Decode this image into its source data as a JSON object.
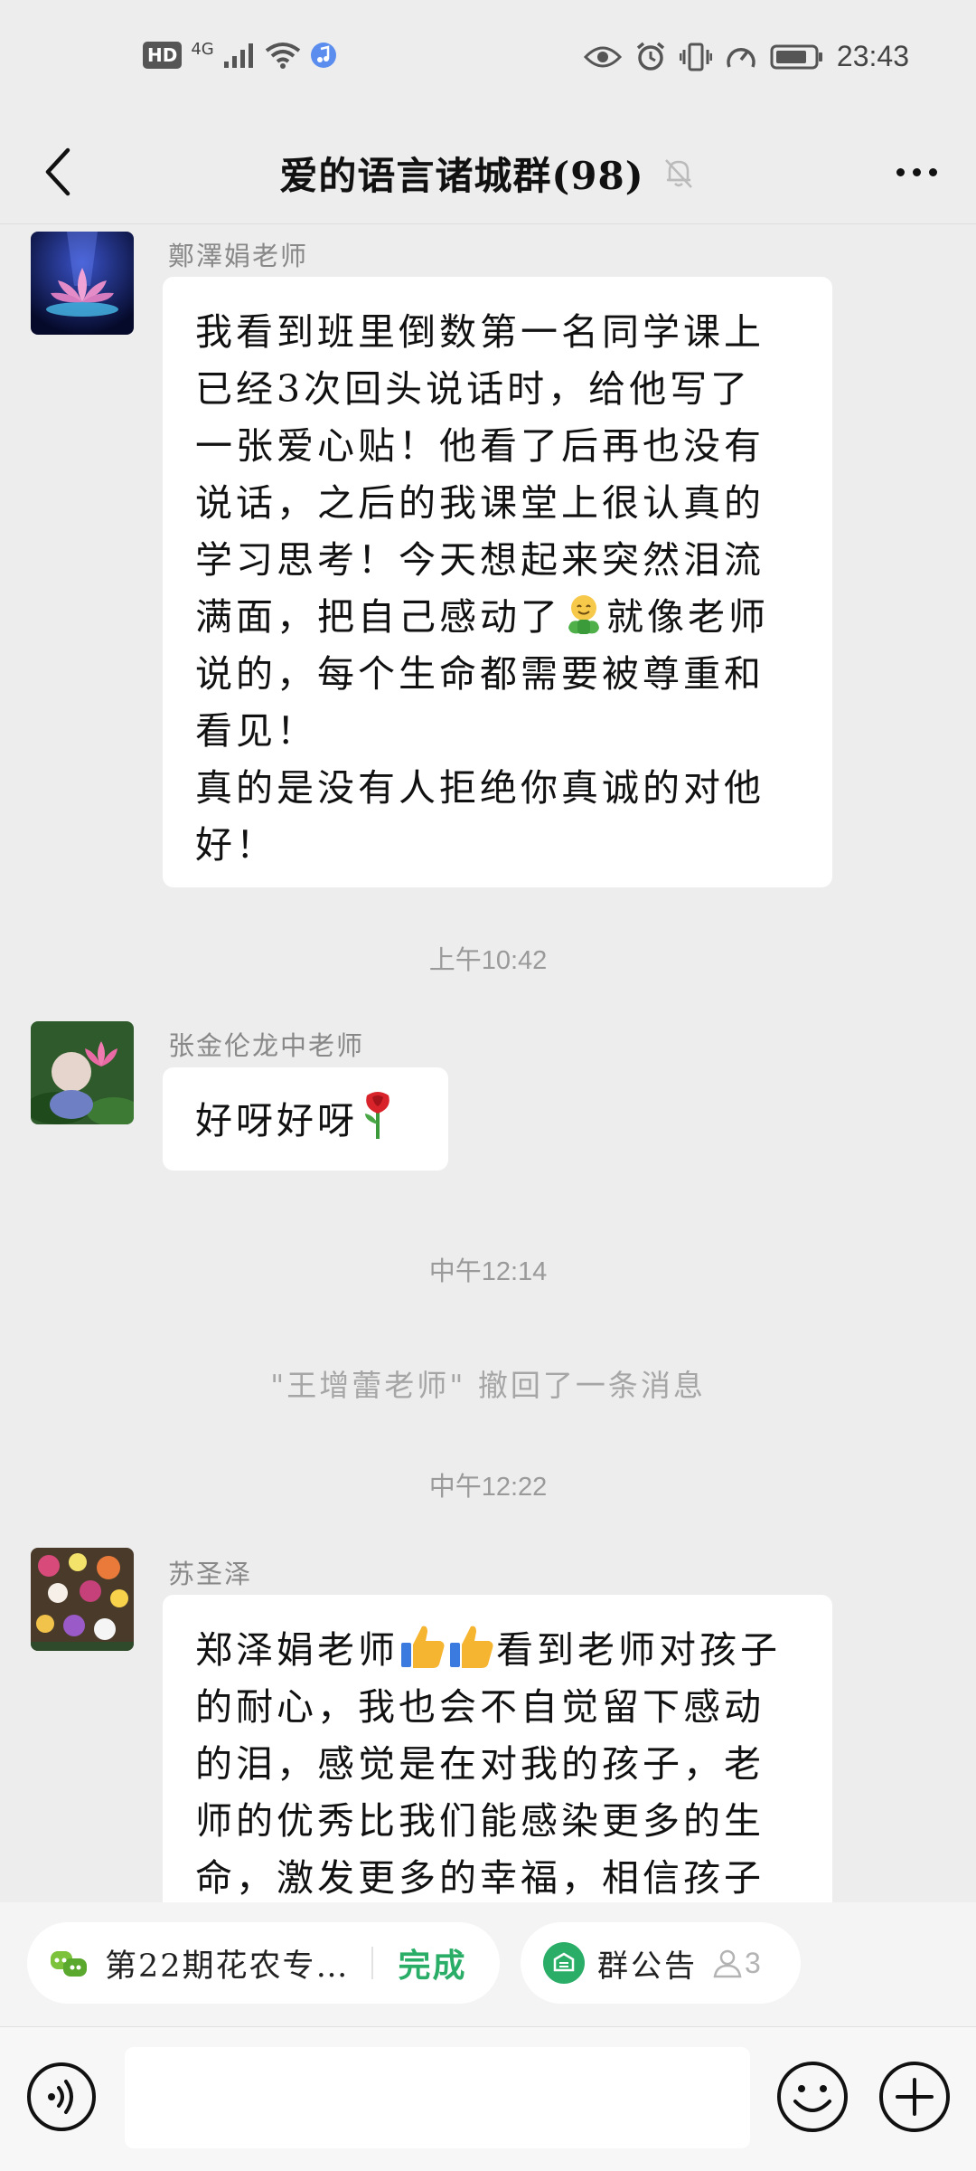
{
  "status_bar": {
    "hd": "HD",
    "network": "4G",
    "time": "23:43"
  },
  "header": {
    "title": "爱的语言诸城群(98)"
  },
  "messages": [
    {
      "sender": "鄭澤娟老师",
      "lines": [
        "我看到班里倒数第一名同学课上",
        "已经3次回头说话时，给他写了",
        "一张爱心贴！他看了后再也没有",
        "说话，之后的我课堂上很认真的",
        "学习思考！今天想起来突然泪流",
        "满面，把自己感动了",
        "就像老师",
        "说的，每个生命都需要被尊重和",
        "看见！",
        "真的是没有人拒绝你真诚的对他",
        "好！"
      ]
    },
    {
      "timestamp": "上午10:42"
    },
    {
      "sender": "张金伦龙中老师",
      "text": "好呀好呀"
    },
    {
      "timestamp": "中午12:14"
    },
    {
      "recall": "\"王增蕾老师\" 撤回了一条消息"
    },
    {
      "timestamp": "中午12:22"
    },
    {
      "sender": "苏圣泽",
      "lines": [
        "郑泽娟老师",
        "看到老师对孩子",
        "的耐心，我也会不自觉留下感动",
        "的泪，感觉是在对我的孩子，老",
        "师的优秀比我们能感染更多的生",
        "命，激发更多的幸福，相信孩子"
      ]
    }
  ],
  "bottom_pills": {
    "extension_label": "第22期花农专…",
    "done_label": "完成",
    "announcement_label": "群公告",
    "announcement_count": "3"
  },
  "input": {
    "placeholder": ""
  },
  "colors": {
    "background": "#ededed",
    "bubble": "#ffffff",
    "accent_green": "#2aae67"
  },
  "icons": [
    "back-arrow-icon",
    "mute-bell-icon",
    "more-icon",
    "voice-icon",
    "emoji-face-icon",
    "plus-icon",
    "miniprogram-icon",
    "announcement-icon",
    "person-icon",
    "hugging-face-emoji",
    "rose-emoji",
    "thumbs-up-emoji"
  ]
}
